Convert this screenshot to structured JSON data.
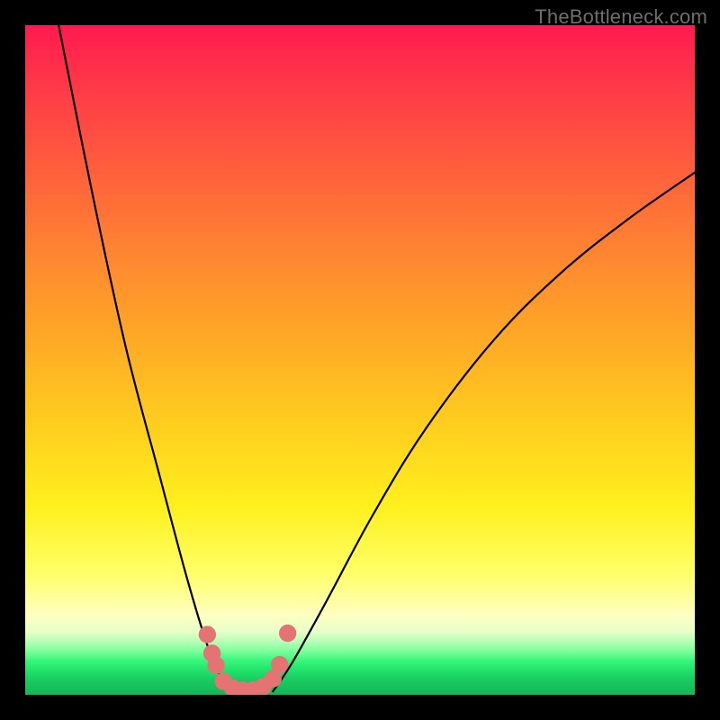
{
  "watermark": "TheBottleneck.com",
  "chart_data": {
    "type": "line",
    "title": "",
    "xlabel": "",
    "ylabel": "",
    "xlim": [
      0,
      100
    ],
    "ylim": [
      0,
      100
    ],
    "grid": false,
    "legend": false,
    "gradient_stops": [
      {
        "pct": 0,
        "color": "#ff1a51"
      },
      {
        "pct": 8,
        "color": "#ff3549"
      },
      {
        "pct": 20,
        "color": "#ff5a3e"
      },
      {
        "pct": 33,
        "color": "#ff8232"
      },
      {
        "pct": 46,
        "color": "#ffa726"
      },
      {
        "pct": 60,
        "color": "#ffcf1e"
      },
      {
        "pct": 72,
        "color": "#fff01e"
      },
      {
        "pct": 82,
        "color": "#ffff6a"
      },
      {
        "pct": 88,
        "color": "#ffffc0"
      },
      {
        "pct": 90.5,
        "color": "#e8ffc8"
      },
      {
        "pct": 92,
        "color": "#b8ffb8"
      },
      {
        "pct": 93.5,
        "color": "#7aff9a"
      },
      {
        "pct": 95,
        "color": "#35f57a"
      },
      {
        "pct": 96.5,
        "color": "#1fe06a"
      },
      {
        "pct": 98,
        "color": "#19c95f"
      },
      {
        "pct": 100,
        "color": "#15b556"
      }
    ],
    "series": [
      {
        "name": "left-curve",
        "stroke": "#000000",
        "points": [
          {
            "x": 5,
            "y": 100
          },
          {
            "x": 10,
            "y": 75
          },
          {
            "x": 15,
            "y": 52
          },
          {
            "x": 20,
            "y": 33
          },
          {
            "x": 24,
            "y": 18
          },
          {
            "x": 27,
            "y": 8
          },
          {
            "x": 29,
            "y": 3
          },
          {
            "x": 30.5,
            "y": 0.5
          }
        ]
      },
      {
        "name": "right-curve",
        "stroke": "#000000",
        "points": [
          {
            "x": 37,
            "y": 0.5
          },
          {
            "x": 40,
            "y": 5
          },
          {
            "x": 45,
            "y": 14
          },
          {
            "x": 52,
            "y": 27
          },
          {
            "x": 60,
            "y": 40
          },
          {
            "x": 70,
            "y": 53
          },
          {
            "x": 80,
            "y": 63
          },
          {
            "x": 90,
            "y": 71
          },
          {
            "x": 100,
            "y": 78
          }
        ]
      }
    ],
    "marker_series": {
      "name": "bottom-markers",
      "color": "#e57373",
      "radius_pct": 1.3,
      "points": [
        {
          "x": 27.2,
          "y": 9.0
        },
        {
          "x": 27.9,
          "y": 6.2
        },
        {
          "x": 28.5,
          "y": 4.4
        },
        {
          "x": 29.6,
          "y": 2.0
        },
        {
          "x": 31.0,
          "y": 1.0
        },
        {
          "x": 32.5,
          "y": 0.7
        },
        {
          "x": 34.0,
          "y": 0.7
        },
        {
          "x": 35.5,
          "y": 1.2
        },
        {
          "x": 37.0,
          "y": 2.4
        },
        {
          "x": 38.0,
          "y": 4.5
        },
        {
          "x": 39.2,
          "y": 9.2
        }
      ]
    }
  }
}
